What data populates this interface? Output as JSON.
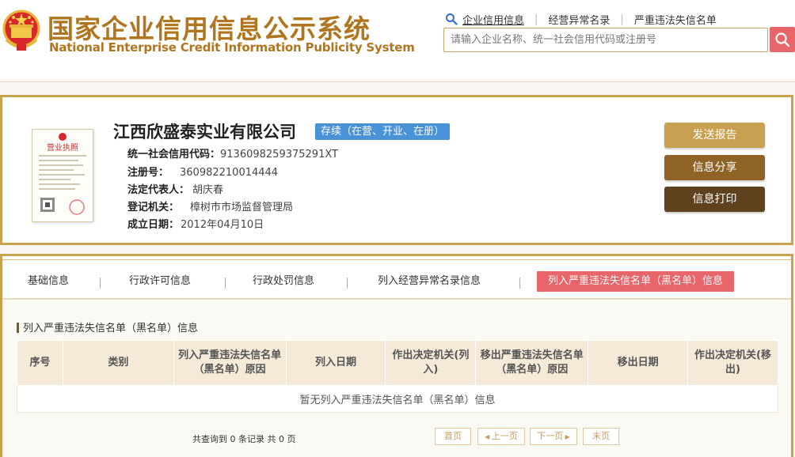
{
  "header": {
    "title_cn": "国家企业信用信息公示系统",
    "title_en": "National Enterprise Credit Information Publicity System",
    "emblem_icon": "national-emblem-icon",
    "topnav": [
      {
        "label": "企业信用信息",
        "active": true
      },
      {
        "label": "经营异常名录",
        "active": false
      },
      {
        "label": "严重违法失信名单",
        "active": false
      }
    ],
    "search": {
      "placeholder": "请输入企业名称、统一社会信用代码或注册号",
      "value": "",
      "button_icon": "search-icon"
    }
  },
  "company": {
    "name": "江西欣盛泰实业有限公司",
    "status": "存续（在营、开业、在册）",
    "fields": [
      {
        "label": "统一社会信用代码：",
        "value": "9136098259375291XT"
      },
      {
        "label": "注册号：",
        "value": "360982210014444"
      },
      {
        "label": "法定代表人：",
        "value": "胡庆春"
      },
      {
        "label": "登记机关：",
        "value": "樟树市市场监督管理局"
      },
      {
        "label": "成立日期：",
        "value": "2012年04月10日"
      }
    ],
    "license_text": "营业执照",
    "actions": [
      {
        "label": "发送报告",
        "color": "#c9a051"
      },
      {
        "label": "信息分享",
        "color": "#8f6325"
      },
      {
        "label": "信息打印",
        "color": "#5e421d"
      }
    ]
  },
  "tabs": [
    {
      "label": "基础信息",
      "active": false
    },
    {
      "label": "行政许可信息",
      "active": false
    },
    {
      "label": "行政处罚信息",
      "active": false
    },
    {
      "label": "列入经营异常名录信息",
      "active": false
    },
    {
      "label": "列入严重违法失信名单（黑名单）信息",
      "active": true
    }
  ],
  "section": {
    "title": "列入严重违法失信名单（黑名单）信息",
    "columns": [
      "序号",
      "类别",
      "列入严重违法失信名单（黑名单）原因",
      "列入日期",
      "作出决定机关(列入)",
      "移出严重违法失信名单（黑名单）原因",
      "移出日期",
      "作出决定机关(移出)"
    ],
    "empty_text": "暂无列入严重违法失信名单（黑名单）信息"
  },
  "pager": {
    "info": "共查询到 0 条记录 共 0 页",
    "first": "首页",
    "prev": "上一页",
    "next": "下一页",
    "last": "末页"
  },
  "colors": {
    "brand_gold": "#b0751f",
    "border_gold": "#c9a24f",
    "accent_red": "#e8656a",
    "status_blue": "#4a92d8"
  }
}
